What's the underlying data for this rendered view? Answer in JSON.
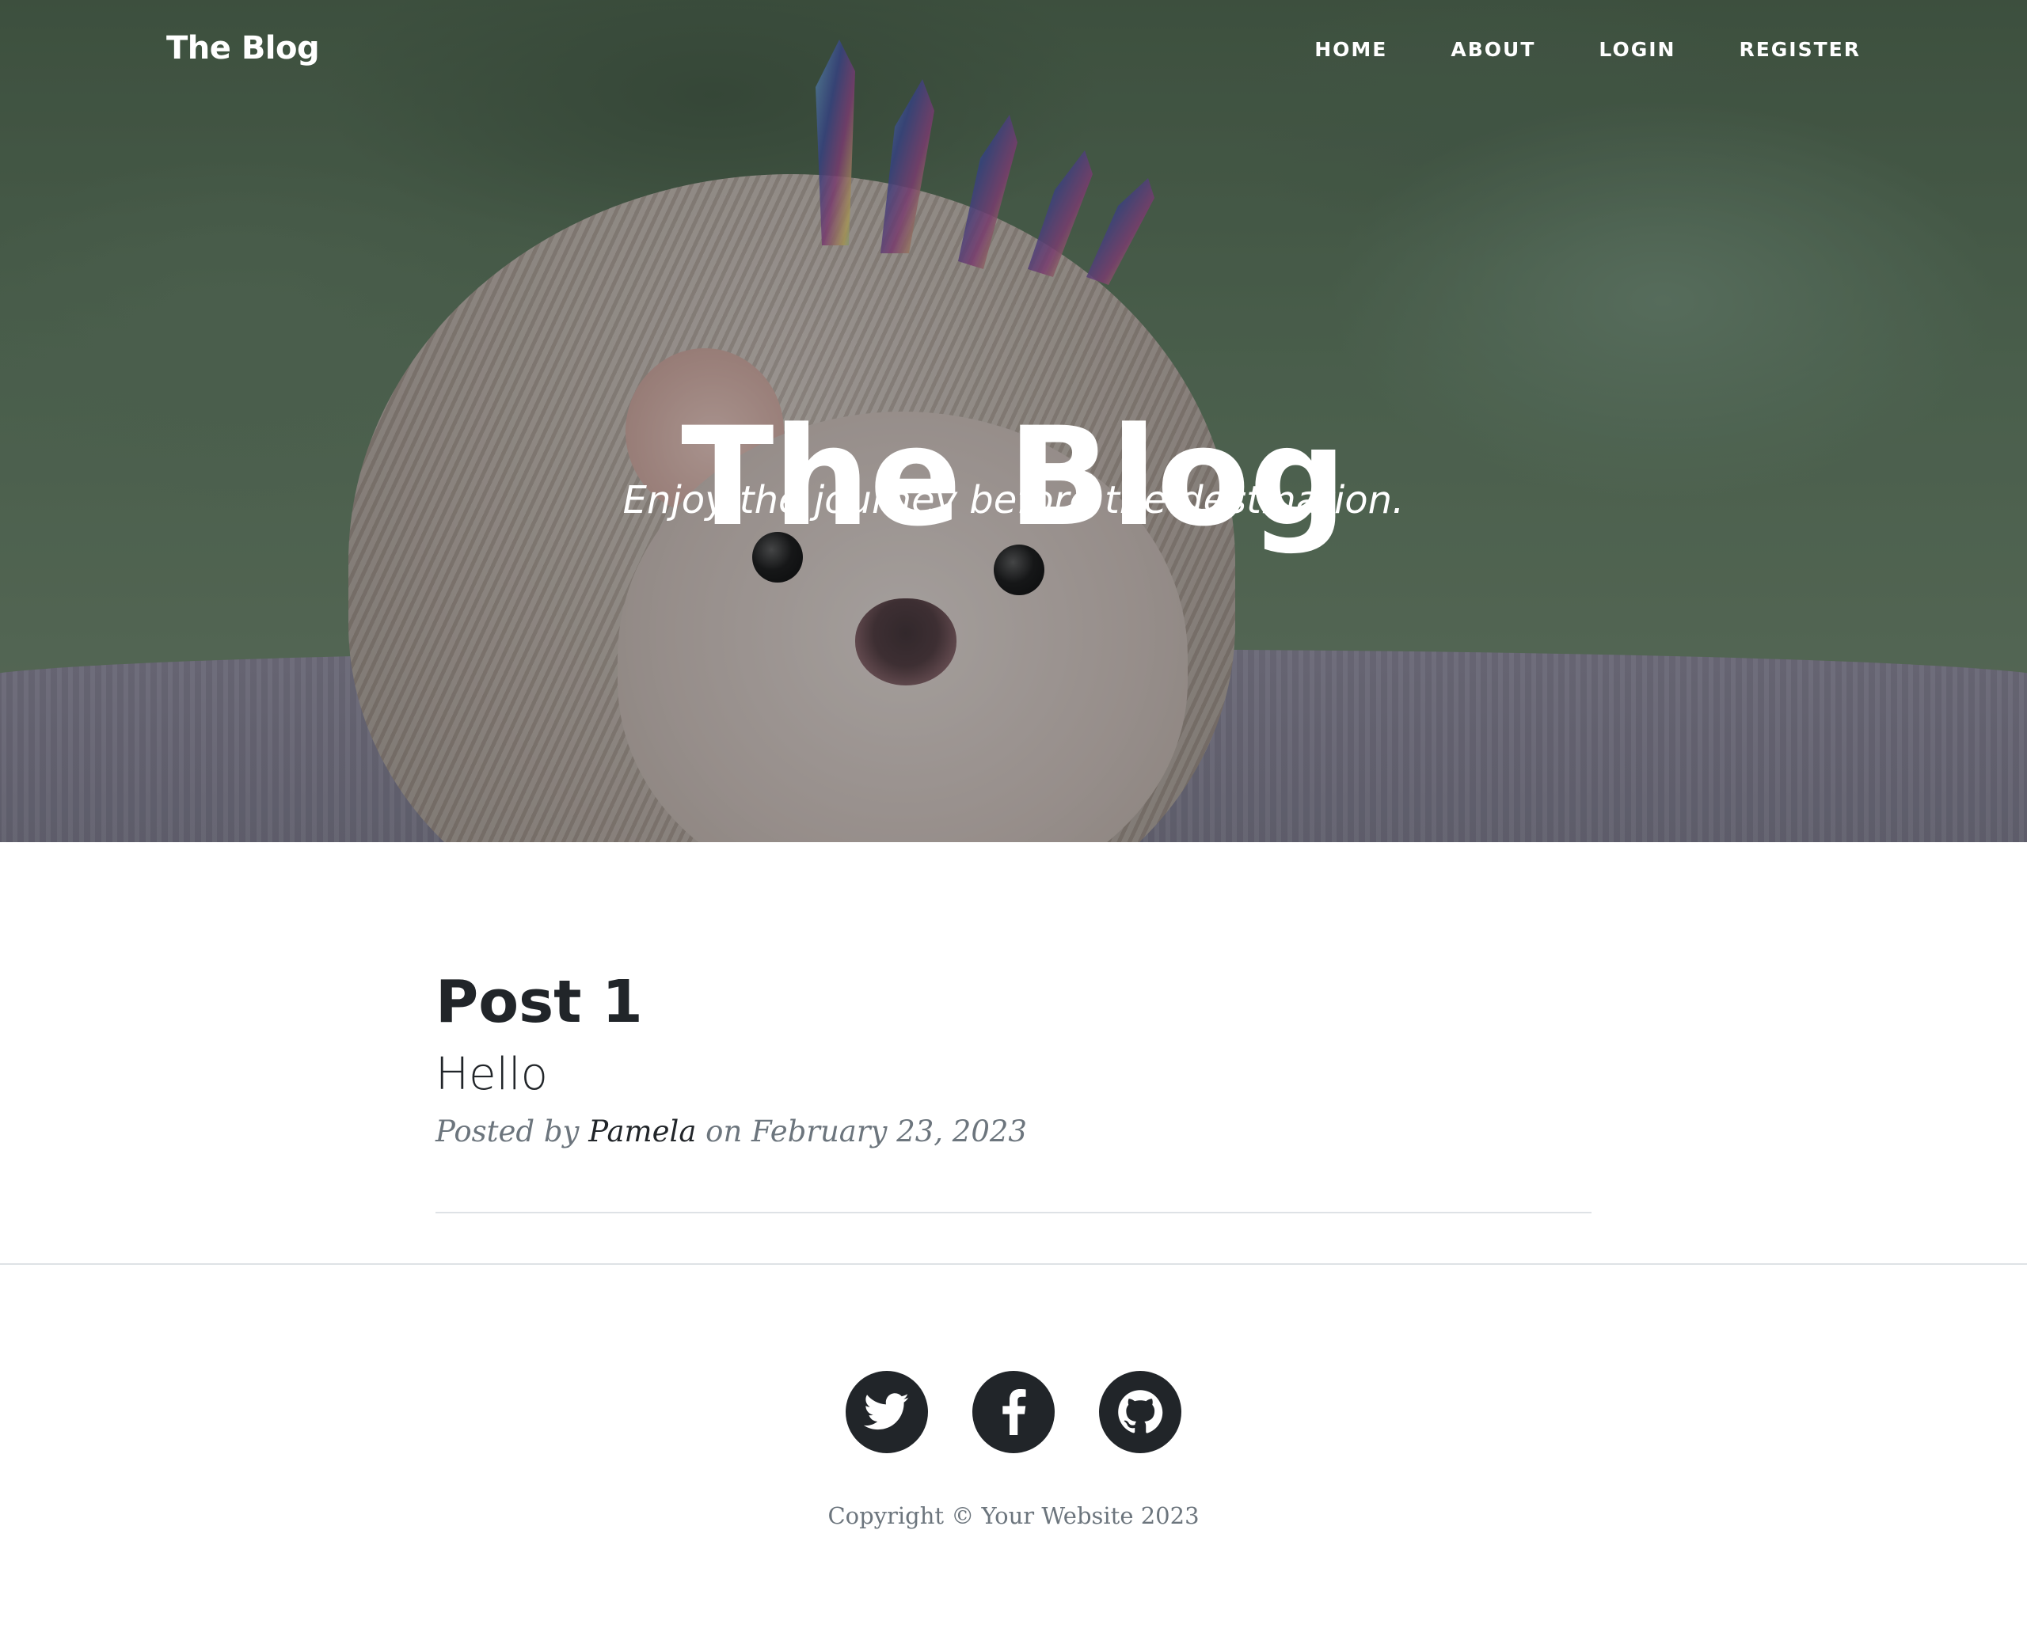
{
  "navbar": {
    "brand": "The Blog",
    "links": [
      "Home",
      "About",
      "Login",
      "Register"
    ]
  },
  "hero": {
    "title": "The Blog",
    "subtitle": "Enjoy the journey before the destination."
  },
  "posts": [
    {
      "title": "Post 1",
      "subtitle": "Hello",
      "meta_prefix": "Posted by",
      "author": "Pamela",
      "meta_date": "on February 23, 2023"
    }
  ],
  "footer": {
    "social": [
      "twitter-icon",
      "facebook-icon",
      "github-icon"
    ],
    "copyright": "Copyright © Your Website 2023"
  },
  "colors": {
    "text_dark": "#212529",
    "text_muted": "#6c757d",
    "divider": "#dee2e6",
    "white": "#ffffff"
  }
}
